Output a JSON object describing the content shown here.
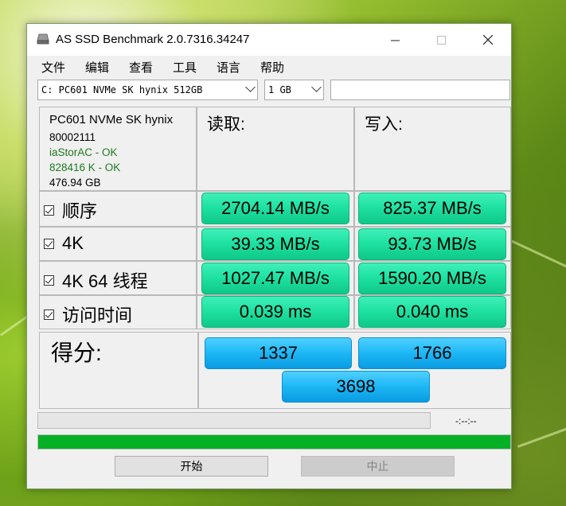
{
  "window": {
    "title": "AS SSD Benchmark 2.0.7316.34247"
  },
  "menu": [
    "文件",
    "编辑",
    "查看",
    "工具",
    "语言",
    "帮助"
  ],
  "drive_select": {
    "value": "C: PC601 NVMe SK hynix 512GB"
  },
  "size_select": {
    "value": "1 GB"
  },
  "info": {
    "model": "PC601 NVMe SK hynix",
    "firmware": "80002111",
    "driver": "iaStorAC - OK",
    "alignment": "828416 K - OK",
    "capacity": "476.94 GB"
  },
  "headers": {
    "read": "读取:",
    "write": "写入:"
  },
  "rows": [
    {
      "label": "顺序",
      "read": "2704.14 MB/s",
      "write": "825.37 MB/s"
    },
    {
      "label": "4K",
      "read": "39.33 MB/s",
      "write": "93.73 MB/s"
    },
    {
      "label": "4K 64 线程",
      "read": "1027.47 MB/s",
      "write": "1590.20 MB/s"
    },
    {
      "label": "访问时间",
      "read": "0.039 ms",
      "write": "0.040 ms"
    }
  ],
  "score": {
    "label": "得分:",
    "read": "1337",
    "write": "1766",
    "total": "3698"
  },
  "progress": {
    "time": "-:--:--",
    "fraction": 1.0
  },
  "buttons": {
    "start": "开始",
    "stop": "中止"
  },
  "colors": {
    "result": "#1fe2a2",
    "score": "#1db7f5",
    "progress": "#06b025"
  }
}
